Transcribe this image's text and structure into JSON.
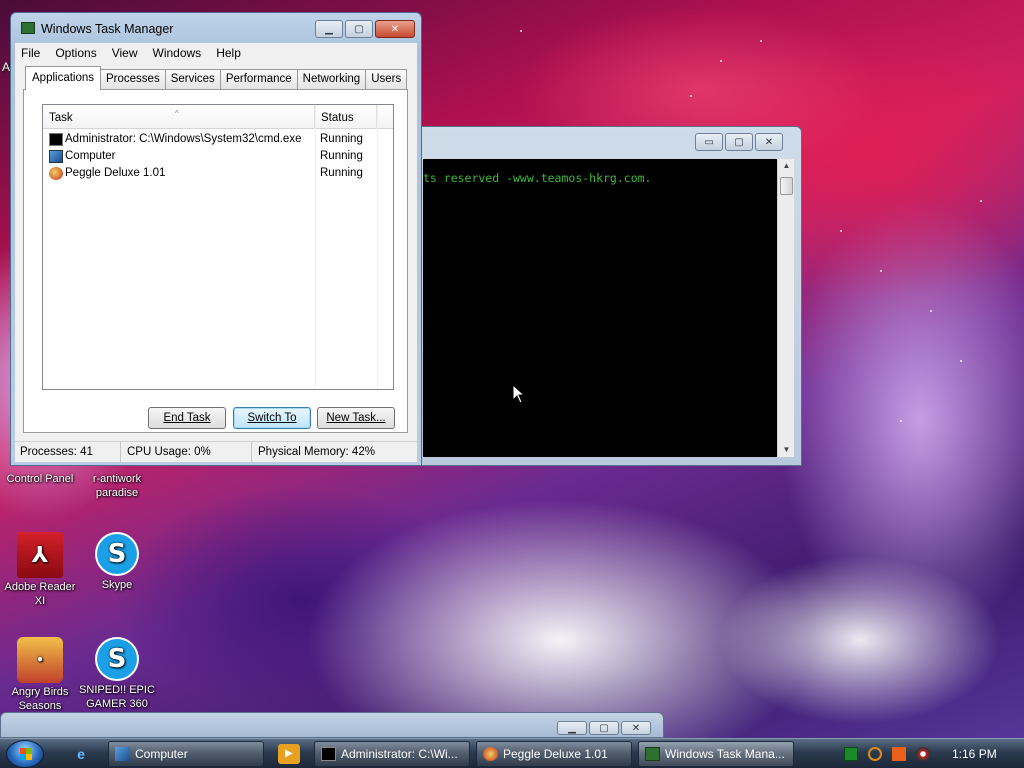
{
  "desktop": {
    "icons": [
      {
        "label": "Control Panel"
      },
      {
        "label": "r-antiwork paradise"
      },
      {
        "label": "Adobe Reader XI"
      },
      {
        "label": "Skype"
      },
      {
        "label": "Angry Birds Seasons"
      },
      {
        "label": "SNIPED!! EPIC GAMER 360"
      }
    ],
    "top_left_fragment": "A"
  },
  "console": {
    "text": "ts reserved -www.teamos-hkrg.com.",
    "buttons": {
      "minimize": "▭",
      "maximize": "▢",
      "close": "✕"
    }
  },
  "task_manager": {
    "title": "Windows Task Manager",
    "menu": [
      "File",
      "Options",
      "View",
      "Windows",
      "Help"
    ],
    "tabs": [
      "Applications",
      "Processes",
      "Services",
      "Performance",
      "Networking",
      "Users"
    ],
    "active_tab": "Applications",
    "columns": {
      "task": "Task",
      "status": "Status"
    },
    "rows": [
      {
        "task": "Administrator: C:\\Windows\\System32\\cmd.exe",
        "status": "Running"
      },
      {
        "task": "Computer",
        "status": "Running"
      },
      {
        "task": "Peggle Deluxe 1.01",
        "status": "Running"
      }
    ],
    "buttons": {
      "end_task": "End Task",
      "switch_to": "Switch To",
      "new_task": "New Task..."
    },
    "status": {
      "processes": "Processes: 41",
      "cpu": "CPU Usage: 0%",
      "memory": "Physical Memory: 42%"
    }
  },
  "taskbar": {
    "buttons": [
      {
        "label": "Computer"
      },
      {
        "label": "Administrator: C:\\Wi..."
      },
      {
        "label": "Peggle Deluxe 1.01"
      },
      {
        "label": "Windows Task Mana..."
      }
    ],
    "clock": "1:16 PM"
  },
  "colors": {
    "console_text": "#3cb83c",
    "titlebar": "#bfd4ea"
  }
}
